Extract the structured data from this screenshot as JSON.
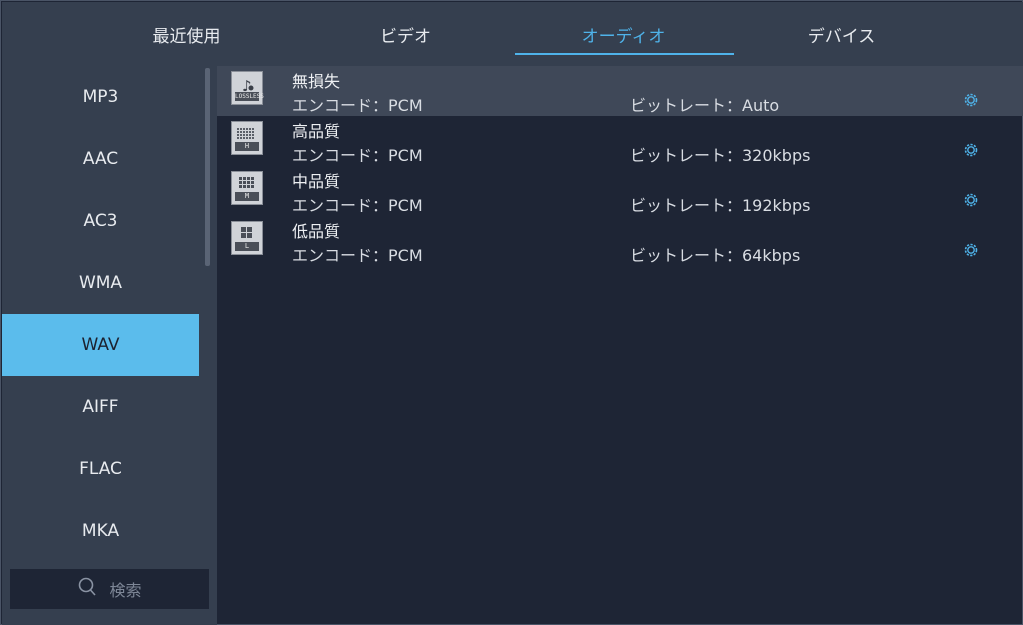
{
  "tabs": [
    {
      "label": "最近使用"
    },
    {
      "label": "ビデオ"
    },
    {
      "label": "オーディオ"
    },
    {
      "label": "デバイス"
    }
  ],
  "active_tab": "オーディオ",
  "sidebar": {
    "formats": [
      {
        "label": "MP3"
      },
      {
        "label": "AAC"
      },
      {
        "label": "AC3"
      },
      {
        "label": "WMA"
      },
      {
        "label": "WAV"
      },
      {
        "label": "AIFF"
      },
      {
        "label": "FLAC"
      },
      {
        "label": "MKA"
      }
    ],
    "selected": "WAV",
    "search": {
      "placeholder": "検索"
    }
  },
  "presets": [
    {
      "name": "無損失",
      "encode": "エンコード：PCM",
      "bitrate": "ビットレート：Auto",
      "icon": "lossless-icon",
      "badge": "LOSSLESS"
    },
    {
      "name": "高品質",
      "encode": "エンコード：PCM",
      "bitrate": "ビットレート：320kbps",
      "icon": "high-quality-icon",
      "badge": "H"
    },
    {
      "name": "中品質",
      "encode": "エンコード：PCM",
      "bitrate": "ビットレート：192kbps",
      "icon": "medium-quality-icon",
      "badge": "M"
    },
    {
      "name": "低品質",
      "encode": "エンコード：PCM",
      "bitrate": "ビットレート：64kbps",
      "icon": "low-quality-icon",
      "badge": "L"
    }
  ],
  "colors": {
    "accent": "#4fb3ea",
    "selected_bg": "#5bbcec",
    "panel_bg": "#353f4f",
    "main_bg": "#1e2535",
    "highlight_row": "#3f4858"
  }
}
